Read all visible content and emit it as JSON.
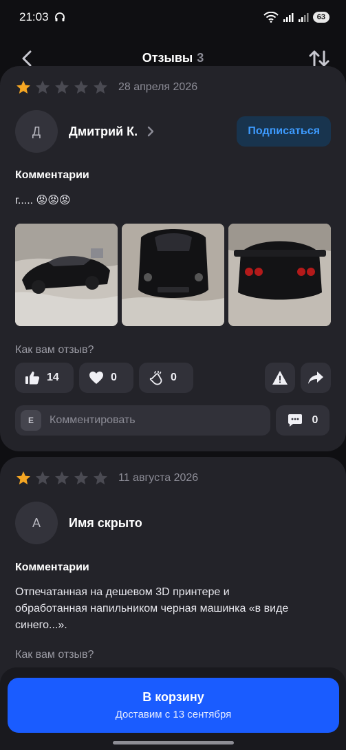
{
  "status_bar": {
    "time": "21:03",
    "battery": "63"
  },
  "header": {
    "title": "Отзывы",
    "count": "3"
  },
  "reviews": [
    {
      "rating": 1,
      "max_rating": 5,
      "date": "28 апреля 2026",
      "author_initial": "Д",
      "author_name": "Дмитрий К.",
      "subscribe_label": "Подписаться",
      "comment_label": "Комментарии",
      "comment_text": "г..... 😡😡😡",
      "question": "Как вам отзыв?",
      "likes": "14",
      "hearts": "0",
      "claps": "0",
      "comment_input_initial": "Е",
      "comment_placeholder": "Комментировать",
      "comments_count": "0"
    },
    {
      "rating": 1,
      "max_rating": 5,
      "date": "11 августа 2026",
      "author_initial": "А",
      "author_name": "Имя скрыто",
      "comment_label": "Комментарии",
      "comment_text": "Отпечатанная на дешевом 3D принтере и обработанная напильником черная машинка «в виде синего...».",
      "question": "Как вам отзыв?"
    }
  ],
  "cart": {
    "title": "В корзину",
    "subtitle": "Доставим с 13 сентября"
  },
  "colors": {
    "accent": "#1a5cff",
    "star_active": "#f5a623",
    "star_inactive": "#4a4a52",
    "subscribe_text": "#3d9bff"
  }
}
